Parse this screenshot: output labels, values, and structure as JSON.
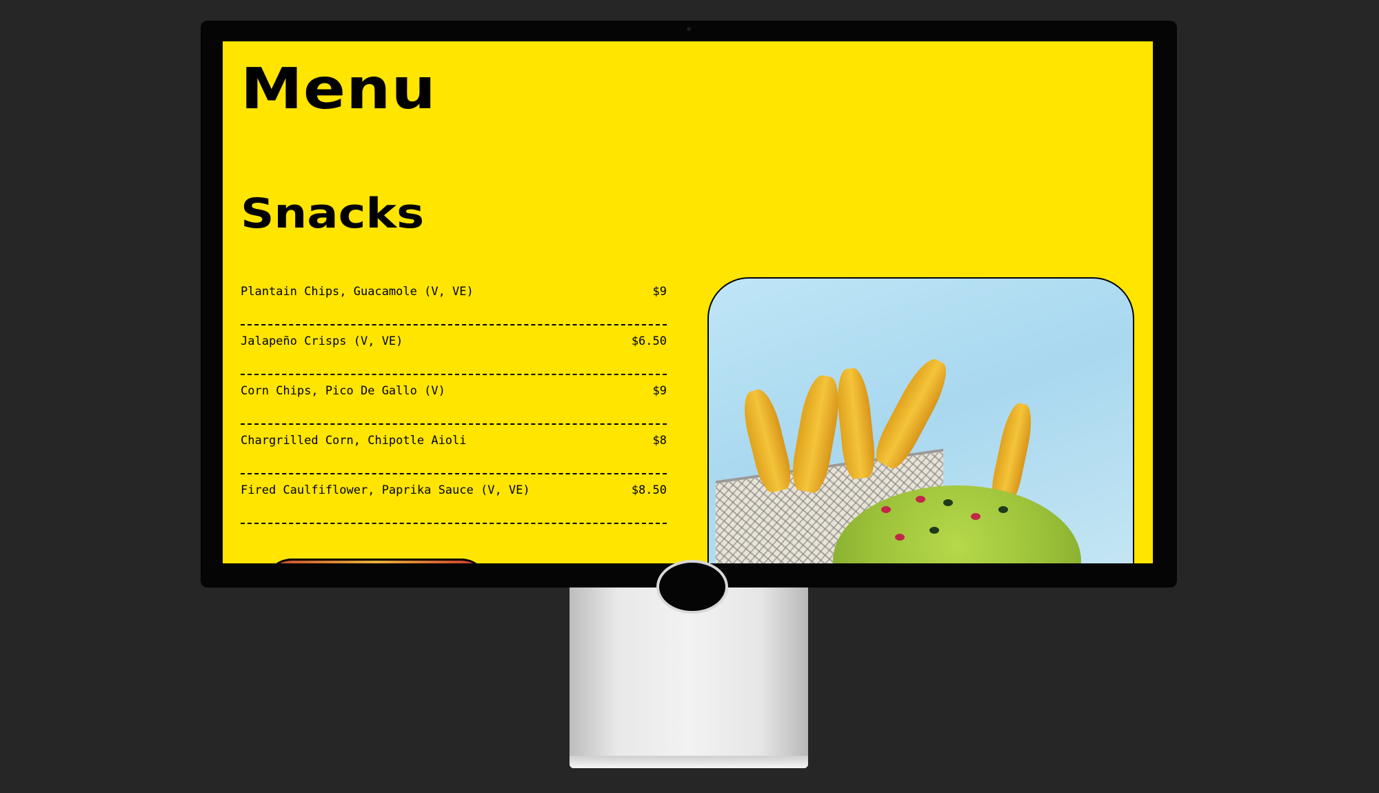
{
  "menu": {
    "title": "Menu",
    "section_title": "Snacks",
    "items": [
      {
        "name": "Plantain Chips, Guacamole (V, VE)",
        "price": "$9"
      },
      {
        "name": "Jalapeño Crisps (V, VE)",
        "price": "$6.50"
      },
      {
        "name": "Corn Chips, Pico De Gallo (V)",
        "price": "$9"
      },
      {
        "name": "Chargrilled Corn, Chipotle Aioli",
        "price": "$8"
      },
      {
        "name": "Fired Caulfiflower, Paprika Sauce (V, VE)",
        "price": "$8.50"
      }
    ]
  },
  "colors": {
    "screen_background": "#FFE500",
    "page_background": "#262626",
    "text": "#000000"
  },
  "icons": {
    "photo": "snack-photo-plantain-chips-guacamole"
  }
}
